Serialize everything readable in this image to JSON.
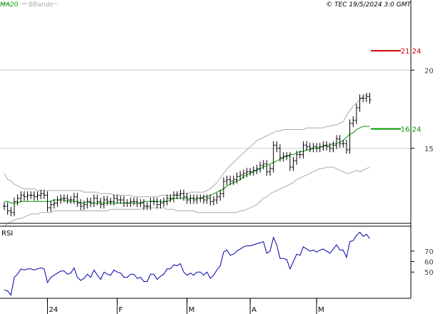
{
  "header": {
    "ma_label": "MA20",
    "bbands_label": "BBands",
    "timestamp": "© TEC 19/5/2024 3:0 GMT"
  },
  "colors": {
    "ma": "#009900",
    "bbands": "#aaaaaa",
    "price": "#000000",
    "resistance": "#cc0000",
    "support": "#009900",
    "rsi": "#0000aa",
    "grid": "#cccccc"
  },
  "chart_data": [
    {
      "type": "ohlc",
      "panel": "price",
      "y_ticks": [
        {
          "value": 15,
          "label": "15"
        },
        {
          "value": 20,
          "label": "20"
        }
      ],
      "ylim": [
        10.2,
        23.8
      ],
      "x_ticks": [
        {
          "label": "24",
          "index": 13
        },
        {
          "label": "F",
          "index": 34
        },
        {
          "label": "M",
          "index": 55
        },
        {
          "label": "A",
          "index": 74
        },
        {
          "label": "M",
          "index": 94
        }
      ],
      "levels": [
        {
          "name": "resistance",
          "value": 21.24,
          "label": "21.24"
        },
        {
          "name": "support",
          "value": 16.24,
          "label": "16.24"
        }
      ],
      "close": [
        11.3,
        11.0,
        10.9,
        11.6,
        11.8,
        12.0,
        11.9,
        12.0,
        12.0,
        11.9,
        12.0,
        12.1,
        12.0,
        11.2,
        11.4,
        11.5,
        11.7,
        11.8,
        11.8,
        11.7,
        11.7,
        11.9,
        11.5,
        11.3,
        11.4,
        11.6,
        11.5,
        11.8,
        11.6,
        11.4,
        11.7,
        11.6,
        11.6,
        11.8,
        11.7,
        11.7,
        11.5,
        11.5,
        11.6,
        11.6,
        11.5,
        11.5,
        11.3,
        11.3,
        11.6,
        11.6,
        11.4,
        11.5,
        11.6,
        11.8,
        11.8,
        12.0,
        12.0,
        12.1,
        11.9,
        11.7,
        11.8,
        11.7,
        11.8,
        11.8,
        11.7,
        11.8,
        11.6,
        11.7,
        11.9,
        12.1,
        12.9,
        13.0,
        12.9,
        13.0,
        13.2,
        13.3,
        13.4,
        13.5,
        13.5,
        13.6,
        13.7,
        13.9,
        14.0,
        13.5,
        13.7,
        15.2,
        15.0,
        14.4,
        14.5,
        14.5,
        13.8,
        14.2,
        14.6,
        14.6,
        15.2,
        15.1,
        15.0,
        15.1,
        15.0,
        15.1,
        15.2,
        15.1,
        15.0,
        15.2,
        15.6,
        15.3,
        15.3,
        14.9,
        16.6,
        16.8,
        17.6,
        18.2,
        18.2,
        18.3,
        18.1
      ],
      "series": [
        {
          "name": "MA20",
          "values": [
            11.6,
            11.6,
            11.5,
            11.5,
            11.5,
            11.6,
            11.6,
            11.6,
            11.6,
            11.6,
            11.6,
            11.6,
            11.6,
            11.6,
            11.6,
            11.7,
            11.7,
            11.7,
            11.7,
            11.6,
            11.6,
            11.6,
            11.6,
            11.5,
            11.5,
            11.6,
            11.5,
            11.5,
            11.5,
            11.5,
            11.5,
            11.5,
            11.5,
            11.5,
            11.5,
            11.5,
            11.5,
            11.5,
            11.5,
            11.5,
            11.5,
            11.5,
            11.6,
            11.6,
            11.6,
            11.6,
            11.6,
            11.6,
            11.6,
            11.6,
            11.7,
            11.8,
            11.8,
            11.8,
            11.8,
            11.8,
            11.8,
            11.8,
            11.8,
            11.8,
            11.9,
            11.9,
            12.0,
            12.1,
            12.2,
            12.3,
            12.4,
            12.6,
            12.7,
            12.8,
            12.9,
            13.0,
            13.2,
            13.3,
            13.4,
            13.5,
            13.6,
            13.7,
            13.8,
            13.9,
            14.0,
            14.1,
            14.2,
            14.3,
            14.4,
            14.5,
            14.6,
            14.6,
            14.7,
            14.8,
            14.8,
            14.9,
            14.9,
            15.0,
            15.0,
            15.1,
            15.1,
            15.2,
            15.2,
            15.3,
            15.3,
            15.4,
            15.5,
            15.7,
            15.9,
            16.0,
            16.2,
            16.3,
            16.4,
            16.4,
            16.4
          ]
        },
        {
          "name": "BB_upper",
          "values": [
            13.4,
            13.0,
            12.9,
            12.7,
            12.6,
            12.5,
            12.4,
            12.4,
            12.4,
            12.4,
            12.3,
            12.3,
            12.3,
            12.3,
            12.3,
            12.3,
            12.3,
            12.3,
            12.3,
            12.3,
            12.3,
            12.3,
            12.3,
            12.3,
            12.2,
            12.2,
            12.2,
            12.2,
            12.2,
            12.1,
            12.1,
            12.1,
            12.1,
            12.0,
            12.0,
            12.0,
            12.0,
            12.0,
            12.0,
            11.9,
            11.9,
            11.9,
            11.9,
            11.9,
            11.9,
            11.9,
            11.9,
            12.0,
            12.0,
            12.0,
            12.0,
            12.0,
            12.1,
            12.1,
            12.1,
            12.1,
            12.2,
            12.2,
            12.2,
            12.2,
            12.2,
            12.3,
            12.4,
            12.6,
            12.8,
            13.1,
            13.4,
            13.7,
            13.9,
            14.1,
            14.3,
            14.5,
            14.7,
            14.9,
            15.1,
            15.3,
            15.5,
            15.6,
            15.7,
            15.8,
            15.9,
            16.0,
            16.1,
            16.1,
            16.2,
            16.2,
            16.2,
            16.2,
            16.2,
            16.2,
            16.2,
            16.3,
            16.3,
            16.3,
            16.3,
            16.3,
            16.3,
            16.4,
            16.4,
            16.5,
            16.5,
            16.6,
            16.7,
            17.1,
            17.4,
            17.7,
            17.9,
            18.1,
            18.3,
            18.4,
            18.4
          ]
        },
        {
          "name": "BB_lower",
          "values": [
            10.0,
            10.2,
            10.3,
            10.4,
            10.5,
            10.5,
            10.6,
            10.7,
            10.8,
            10.8,
            10.8,
            10.9,
            10.9,
            10.9,
            10.9,
            11.0,
            11.0,
            11.0,
            11.0,
            11.0,
            11.0,
            11.0,
            11.0,
            11.0,
            11.0,
            11.0,
            11.0,
            11.0,
            11.0,
            11.0,
            11.0,
            11.0,
            11.1,
            11.1,
            11.1,
            11.1,
            11.1,
            11.1,
            11.1,
            11.1,
            11.1,
            11.1,
            11.2,
            11.2,
            11.2,
            11.2,
            11.2,
            11.2,
            11.2,
            11.1,
            11.1,
            11.1,
            11.0,
            11.0,
            11.0,
            11.0,
            11.0,
            11.0,
            10.9,
            10.9,
            10.9,
            10.9,
            10.9,
            10.9,
            10.9,
            10.9,
            10.9,
            10.9,
            10.9,
            10.9,
            10.9,
            11.0,
            11.0,
            11.1,
            11.2,
            11.3,
            11.4,
            11.6,
            11.8,
            11.9,
            12.1,
            12.2,
            12.3,
            12.4,
            12.5,
            12.6,
            12.7,
            12.8,
            13.0,
            13.1,
            13.2,
            13.3,
            13.4,
            13.5,
            13.6,
            13.7,
            13.7,
            13.8,
            13.8,
            13.8,
            13.7,
            13.6,
            13.5,
            13.4,
            13.4,
            13.5,
            13.6,
            13.5,
            13.6,
            13.7,
            13.8
          ]
        }
      ]
    },
    {
      "type": "line",
      "panel": "rsi",
      "title": "RSI",
      "y_ticks": [
        {
          "value": 50,
          "label": "50"
        },
        {
          "value": 60,
          "label": "60"
        },
        {
          "value": 70,
          "label": "70"
        }
      ],
      "ylim": [
        25,
        93
      ],
      "series": [
        {
          "name": "RSI",
          "values": [
            33,
            32,
            28,
            45,
            48,
            53,
            52,
            53,
            53,
            52,
            53,
            54,
            53,
            40,
            45,
            47,
            49,
            51,
            51,
            48,
            49,
            54,
            45,
            42,
            44,
            48,
            45,
            52,
            47,
            43,
            50,
            48,
            47,
            52,
            50,
            49,
            45,
            45,
            48,
            48,
            44,
            45,
            41,
            41,
            48,
            48,
            43,
            46,
            48,
            53,
            53,
            57,
            56,
            58,
            50,
            47,
            49,
            47,
            50,
            50,
            47,
            50,
            44,
            47,
            52,
            56,
            69,
            71,
            66,
            67,
            70,
            72,
            74,
            75,
            75,
            76,
            77,
            78,
            79,
            68,
            70,
            83,
            76,
            63,
            63,
            62,
            53,
            60,
            67,
            66,
            74,
            72,
            70,
            71,
            69,
            71,
            72,
            70,
            68,
            72,
            76,
            71,
            71,
            64,
            79,
            80,
            85,
            88,
            84,
            86,
            82
          ]
        }
      ]
    }
  ]
}
